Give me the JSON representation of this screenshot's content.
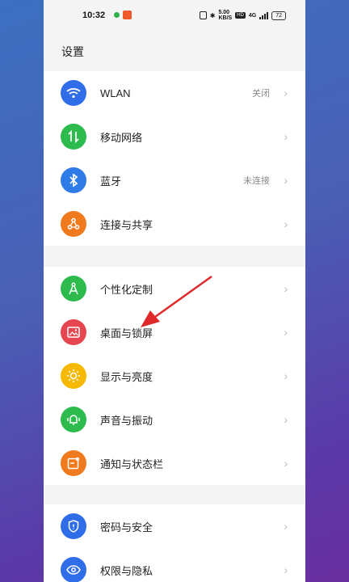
{
  "status": {
    "time": "10:32",
    "app_badge": "新",
    "speed_top": "5.00",
    "speed_bottom": "KB/S",
    "hd": "HD",
    "network": "4G",
    "battery": "72"
  },
  "page_title": "设置",
  "groups": [
    {
      "items": [
        {
          "label": "WLAN",
          "value": "关闭",
          "icon": "wifi-icon",
          "color": "#2f6ee8"
        },
        {
          "label": "移动网络",
          "value": "",
          "icon": "mobile-data-icon",
          "color": "#2dbb4e"
        },
        {
          "label": "蓝牙",
          "value": "未连接",
          "icon": "bluetooth-icon",
          "color": "#2f7be8"
        },
        {
          "label": "连接与共享",
          "value": "",
          "icon": "share-icon",
          "color": "#f07a1e"
        }
      ]
    },
    {
      "items": [
        {
          "label": "个性化定制",
          "value": "",
          "icon": "compass-icon",
          "color": "#2dbb4e"
        },
        {
          "label": "桌面与锁屏",
          "value": "",
          "icon": "wallpaper-icon",
          "color": "#e5464f"
        },
        {
          "label": "显示与亮度",
          "value": "",
          "icon": "brightness-icon",
          "color": "#f6b800"
        },
        {
          "label": "声音与振动",
          "value": "",
          "icon": "bell-icon",
          "color": "#2dbb4e"
        },
        {
          "label": "通知与状态栏",
          "value": "",
          "icon": "notification-icon",
          "color": "#f07a1e"
        }
      ]
    },
    {
      "items": [
        {
          "label": "密码与安全",
          "value": "",
          "icon": "shield-icon",
          "color": "#2f6ee8"
        },
        {
          "label": "权限与隐私",
          "value": "",
          "icon": "privacy-eye-icon",
          "color": "#2f6ee8"
        }
      ]
    }
  ],
  "annotation_color": "#e02a2a"
}
